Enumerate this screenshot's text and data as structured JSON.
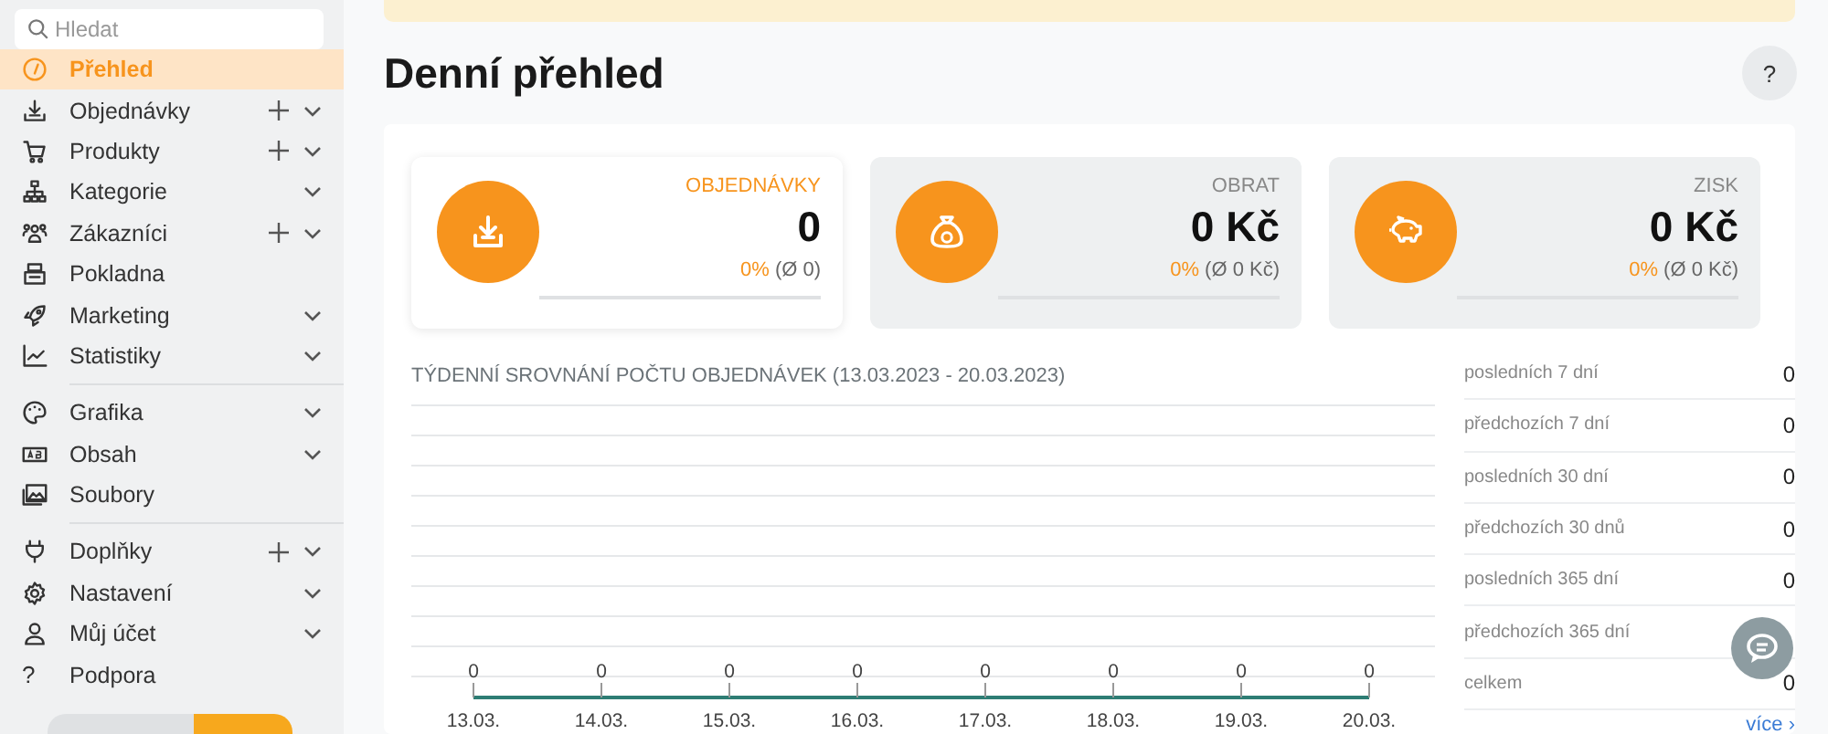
{
  "sidebar": {
    "search": {
      "placeholder": "Hledat"
    },
    "groups": [
      [
        {
          "label": "Přehled",
          "selected": true,
          "add": false,
          "submenu": false
        },
        {
          "label": "Objednávky",
          "selected": false,
          "add": true,
          "submenu": true
        },
        {
          "label": "Produkty",
          "selected": false,
          "add": true,
          "submenu": true
        },
        {
          "label": "Kategorie",
          "selected": false,
          "add": false,
          "submenu": true
        },
        {
          "label": "Zákazníci",
          "selected": false,
          "add": true,
          "submenu": true
        },
        {
          "label": "Pokladna",
          "selected": false,
          "add": false,
          "submenu": false
        },
        {
          "label": "Marketing",
          "selected": false,
          "add": false,
          "submenu": true
        },
        {
          "label": "Statistiky",
          "selected": false,
          "add": false,
          "submenu": true
        }
      ],
      [
        {
          "label": "Grafika",
          "selected": false,
          "add": false,
          "submenu": true
        },
        {
          "label": "Obsah",
          "selected": false,
          "add": false,
          "submenu": true
        },
        {
          "label": "Soubory",
          "selected": false,
          "add": false,
          "submenu": false
        }
      ],
      [
        {
          "label": "Doplňky",
          "selected": false,
          "add": true,
          "submenu": true
        },
        {
          "label": "Nastavení",
          "selected": false,
          "add": false,
          "submenu": true
        },
        {
          "label": "Můj účet",
          "selected": false,
          "add": false,
          "submenu": true
        },
        {
          "label": "Podpora",
          "selected": false,
          "add": false,
          "submenu": false,
          "glyph": "?"
        }
      ]
    ]
  },
  "page": {
    "title": "Denní přehled",
    "help": "?"
  },
  "cards": [
    {
      "label": "OBJEDNÁVKY",
      "value": "0",
      "change": "0%",
      "average": "(Ø 0)",
      "selected": true
    },
    {
      "label": "OBRAT",
      "value": "0 Kč",
      "change": "0%",
      "average": "(Ø 0 Kč)",
      "selected": false
    },
    {
      "label": "ZISK",
      "value": "0 Kč",
      "change": "0%",
      "average": "(Ø 0 Kč)",
      "selected": false
    }
  ],
  "chart": {
    "title": "TÝDENNÍ SROVNÁNÍ POČTU OBJEDNÁVEK (13.03.2023 - 20.03.2023)",
    "kind": "line",
    "categories": [
      "13.03.",
      "14.03.",
      "15.03.",
      "16.03.",
      "17.03.",
      "18.03.",
      "19.03.",
      "20.03."
    ],
    "point_labels": [
      "0",
      "0",
      "0",
      "0",
      "0",
      "0",
      "0",
      "0"
    ]
  },
  "stats": [
    {
      "label": "posledních 7 dní",
      "value": "0"
    },
    {
      "label": "předchozích 7 dní",
      "value": "0"
    },
    {
      "label": "posledních 30 dní",
      "value": "0"
    },
    {
      "label": "předchozích 30 dnů",
      "value": "0"
    },
    {
      "label": "posledních 365 dní",
      "value": "0"
    },
    {
      "label": "předchozích 365 dní"
    },
    {
      "label": "celkem",
      "value": "0"
    }
  ],
  "more_link": "více ›"
}
